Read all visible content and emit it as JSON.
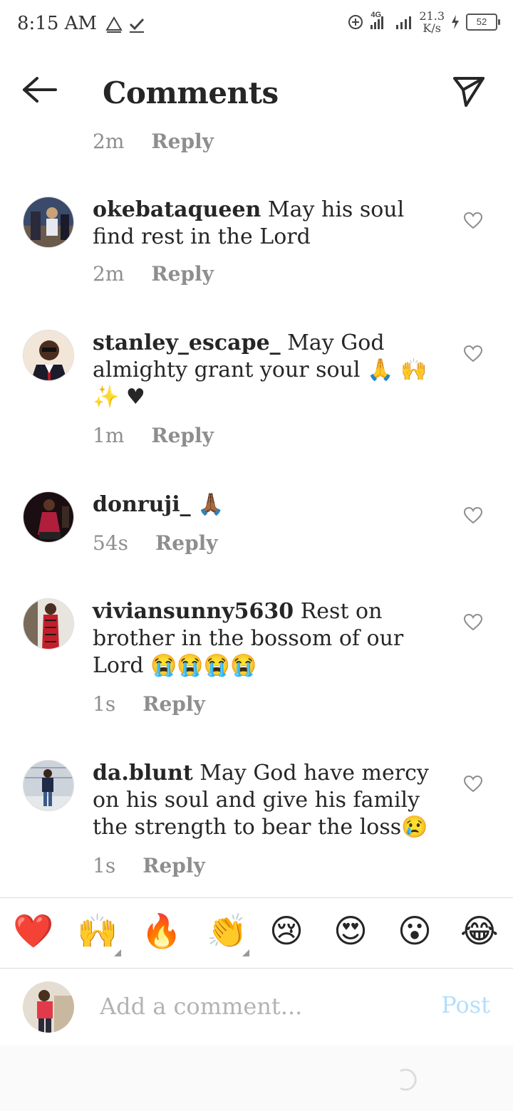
{
  "status_bar": {
    "time": "8:15 AM",
    "network": "4G",
    "speed_value": "21.3",
    "speed_unit": "K/s",
    "battery": "52"
  },
  "header": {
    "title": "Comments",
    "back_icon": "arrow-left-icon",
    "send_icon": "paper-plane-icon"
  },
  "previous_meta": {
    "time": "2m",
    "reply": "Reply"
  },
  "comments": [
    {
      "username": "okebataqueen",
      "text": " May his soul find rest in the Lord",
      "time": "2m",
      "reply": "Reply"
    },
    {
      "username": "stanley_escape_",
      "text": " May God almighty grant your soul 🙏 🙌 ✨ ♥",
      "time": "1m",
      "reply": "Reply"
    },
    {
      "username": "donruji_",
      "text": " 🙏🏾",
      "time": "54s",
      "reply": "Reply"
    },
    {
      "username": "viviansunny5630",
      "text": " Rest on brother in the bossom of our Lord 😭😭😭😭",
      "time": "1s",
      "reply": "Reply"
    },
    {
      "username": "da.blunt",
      "text": " May God have mercy on his soul and give his family the strength to bear the loss😢",
      "time": "1s",
      "reply": "Reply"
    }
  ],
  "emoji_bar": [
    "❤️",
    "🙌",
    "🔥",
    "👏",
    "😢",
    "😍",
    "😮",
    "😂"
  ],
  "composer": {
    "placeholder": "Add a comment...",
    "post_label": "Post"
  },
  "colors": {
    "text": "#262626",
    "meta": "#8e8e8e",
    "post_disabled": "#b2dffc",
    "divider": "#dbdbdb"
  }
}
